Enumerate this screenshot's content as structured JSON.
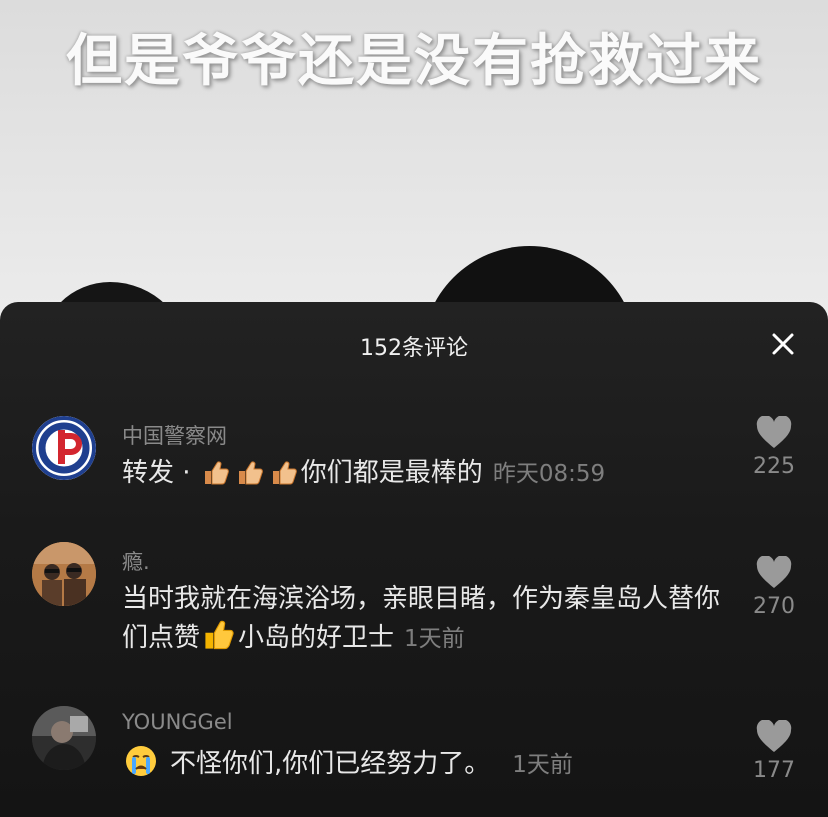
{
  "video": {
    "subtitle": "但是爷爷还是没有抢救过来"
  },
  "panel": {
    "title": "152条评论"
  },
  "comments": [
    {
      "user": "中国警察网",
      "text_prefix": "转发 · ",
      "text_suffix": "你们都是最棒的",
      "time": "昨天08:59",
      "likes": "225",
      "emoji": "thumbs-up"
    },
    {
      "user": "瘾.",
      "text_prefix": "当时我就在海滨浴场，亲眼目睹，作为秦皇岛人替你们点赞",
      "text_suffix": "小岛的好卫士",
      "time": "1天前",
      "likes": "270",
      "emoji": "thumbs-up"
    },
    {
      "user": "YOUNGGel",
      "text_prefix": "",
      "text_suffix": "不怪你们,你们已经努力了。",
      "time": "1天前",
      "likes": "177",
      "emoji": "crying-face"
    }
  ],
  "colors": {
    "panel_bg": "#1a1a1a",
    "username": "#8a8a8a",
    "text": "#e8e8e8",
    "like_icon": "#9a9a9a",
    "police_logo_blue": "#1f3f8f",
    "police_logo_red": "#d3262f"
  }
}
